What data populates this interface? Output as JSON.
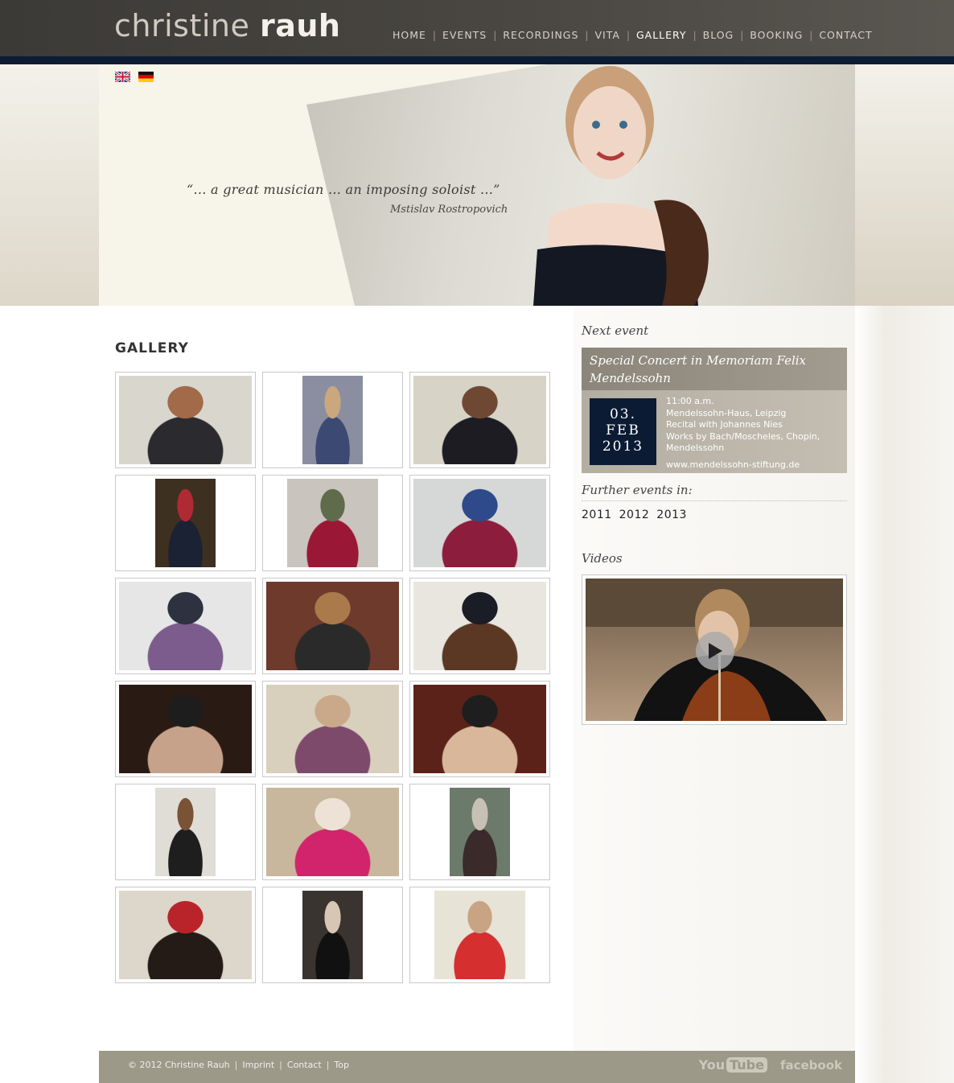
{
  "header": {
    "logo_first": "christine",
    "logo_second": "rauh",
    "nav": [
      {
        "label": "HOME",
        "active": false
      },
      {
        "label": "EVENTS",
        "active": false
      },
      {
        "label": "RECORDINGS",
        "active": false
      },
      {
        "label": "VITA",
        "active": false
      },
      {
        "label": "GALLERY",
        "active": true
      },
      {
        "label": "BLOG",
        "active": false
      },
      {
        "label": "BOOKING",
        "active": false
      },
      {
        "label": "CONTACT",
        "active": false
      }
    ],
    "nav_separator": "|"
  },
  "languages": [
    {
      "icon": "uk-flag-icon",
      "name": "English"
    },
    {
      "icon": "german-flag-icon",
      "name": "Deutsch"
    }
  ],
  "hero": {
    "quote": "“... a great musician ... an imposing soloist ...”",
    "quote_author": "Mstislav Rostropovich"
  },
  "gallery": {
    "title": "GALLERY",
    "thumbnails": [
      {
        "orientation": "land",
        "colors": [
          "#d9d6ce",
          "#2b2a2e",
          "#a26a48"
        ]
      },
      {
        "orientation": "port",
        "colors": [
          "#8a8ea0",
          "#3c4a73",
          "#caa77c"
        ]
      },
      {
        "orientation": "land",
        "colors": [
          "#d7d3c6",
          "#1c1c22",
          "#6f4834"
        ]
      },
      {
        "orientation": "port",
        "colors": [
          "#3e3020",
          "#1a2233",
          "#b02a33"
        ]
      },
      {
        "orientation": "mid",
        "colors": [
          "#c9c4bd",
          "#9a1835",
          "#5f6b4b"
        ]
      },
      {
        "orientation": "land",
        "colors": [
          "#d6d8d8",
          "#8c1d3c",
          "#2f4a8a"
        ]
      },
      {
        "orientation": "land",
        "colors": [
          "#e6e6e6",
          "#7b5c8c",
          "#2e3240"
        ]
      },
      {
        "orientation": "land",
        "colors": [
          "#6d3a2c",
          "#2a2a2a",
          "#aa7a4b"
        ]
      },
      {
        "orientation": "land",
        "colors": [
          "#e8e6df",
          "#5a3824",
          "#1a1c26"
        ]
      },
      {
        "orientation": "land",
        "colors": [
          "#2a1a14",
          "#c7a28a",
          "#1d1d1d"
        ]
      },
      {
        "orientation": "land",
        "colors": [
          "#d8cfbd",
          "#7e4a6c",
          "#c9a98a"
        ]
      },
      {
        "orientation": "land",
        "colors": [
          "#5a2218",
          "#d8b79a",
          "#1e1e1e"
        ]
      },
      {
        "orientation": "port",
        "colors": [
          "#e0ddd6",
          "#1e1e1e",
          "#7a5236"
        ]
      },
      {
        "orientation": "land",
        "colors": [
          "#c8b79c",
          "#d1246d",
          "#ede2d5"
        ]
      },
      {
        "orientation": "port",
        "colors": [
          "#6b7a6a",
          "#3a2a2a",
          "#c6c0b5"
        ]
      },
      {
        "orientation": "land",
        "colors": [
          "#ddd6ca",
          "#241a16",
          "#b8242a"
        ]
      },
      {
        "orientation": "port",
        "colors": [
          "#3a3430",
          "#111111",
          "#d8c6b4"
        ]
      },
      {
        "orientation": "mid",
        "colors": [
          "#e7e3d6",
          "#d52f2f",
          "#c8a484"
        ]
      }
    ]
  },
  "sidebar": {
    "next_event_heading": "Next event",
    "event": {
      "title": "Special Concert in Memoriam Felix Mendelssohn",
      "date_day": "03.",
      "date_month": "FEB",
      "date_year": "2013",
      "time": "11:00 a.m.",
      "venue": "Mendelssohn-Haus, Leipzig",
      "program_1": "Recital with Johannes Nies",
      "program_2": "Works by Bach/Moscheles, Chopin, Mendelssohn",
      "link": "www.mendelssohn-stiftung.de"
    },
    "further_heading": "Further events in:",
    "years": [
      "2011",
      "2012",
      "2013"
    ],
    "videos_heading": "Videos"
  },
  "footer": {
    "copyright": "© 2012 Christine Rauh",
    "links": [
      "Imprint",
      "Contact",
      "Top"
    ],
    "youtube_you": "You",
    "youtube_tube": "Tube",
    "facebook": "facebook"
  },
  "colors": {
    "header_bg": "#3c3a37",
    "stripe": "#0e1c33",
    "date_box": "#0c1b34",
    "footer_bg": "#9c9989",
    "event_bg": "#b4aea2"
  }
}
